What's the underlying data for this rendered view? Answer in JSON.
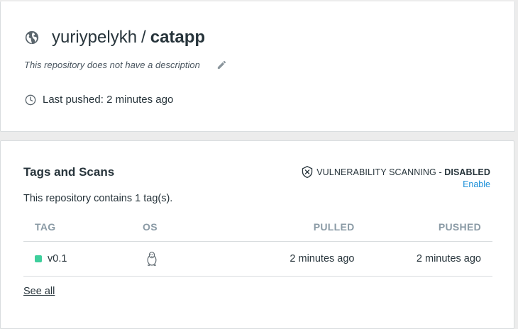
{
  "repository": {
    "owner": "yuriypelykh",
    "separator": "/",
    "name": "catapp",
    "description": "This repository does not have a description",
    "last_pushed": "Last pushed: 2 minutes ago",
    "icons": {
      "visibility": "globe-icon",
      "edit": "pencil-icon",
      "time": "clock-icon"
    }
  },
  "tags_section": {
    "title": "Tags and Scans",
    "vulnerability_label": "VULNERABILITY SCANNING - ",
    "vulnerability_status": "DISABLED",
    "enable_label": "Enable",
    "contains_text": "This repository contains 1 tag(s).",
    "columns": {
      "tag": "TAG",
      "os": "OS",
      "pulled": "PULLED",
      "pushed": "PUSHED"
    },
    "rows": [
      {
        "tag": "v0.1",
        "os_icon": "linux-icon",
        "pulled": "2 minutes ago",
        "pushed": "2 minutes ago",
        "status_color": "#3ecf9c"
      }
    ],
    "see_all_label": "See all"
  },
  "colors": {
    "text": "#27343b",
    "muted": "#8a9aa5",
    "link": "#1a8fd8",
    "border": "#d8dcde",
    "background": "#ececec"
  }
}
